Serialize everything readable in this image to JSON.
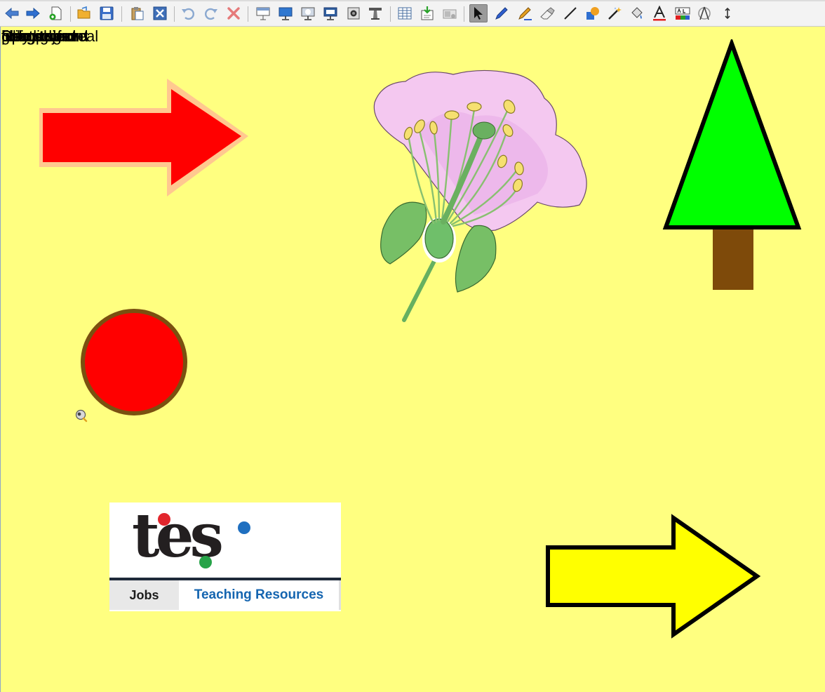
{
  "toolbar": {
    "items": [
      "back-icon",
      "forward-icon",
      "new-page-icon",
      "open-folder-icon",
      "save-icon",
      "paste-icon",
      "delete-page-icon",
      "undo-icon",
      "redo-icon",
      "delete-icon",
      "display-blind-icon",
      "display-screen-icon",
      "display-spotlight-icon",
      "presentation-icon",
      "camera-icon",
      "podium-icon",
      "table-icon",
      "insert-icon",
      "media-icon",
      "select-icon",
      "pen-icon",
      "highlighter-icon",
      "eraser-icon",
      "line-icon",
      "shape-icon",
      "magic-wand-icon",
      "fill-icon",
      "text-icon",
      "colour-text-icon",
      "compass-icon",
      "resize-icon"
    ],
    "active": "select-icon"
  },
  "canvas": {
    "background": "#ffff80",
    "overlapping_labels": [
      "Spin",
      "fill in colour",
      "play sound",
      "Drag to reveal",
      "Spotlight",
      "bring to front",
      "hide object",
      "goto page",
      "link to sound"
    ],
    "tes": {
      "logo": "tes",
      "jobs": "Jobs",
      "teaching_resources": "Teaching Resources"
    }
  },
  "colors": {
    "red_arrow": "#ff0000",
    "red_arrow_glow": "#ffc890",
    "tree_crown": "#00ff00",
    "tree_trunk": "#7e4a0a",
    "red_circle": "#ff0000",
    "circle_border": "#7a5010",
    "yellow_arrow": "#ffff00"
  }
}
